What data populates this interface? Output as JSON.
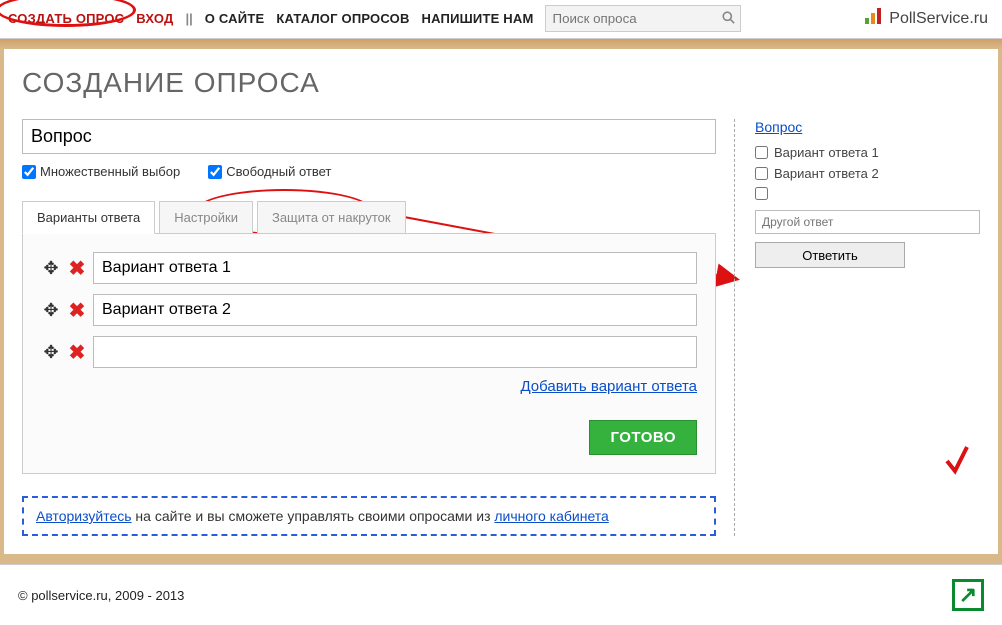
{
  "header": {
    "nav": {
      "create": "СОЗДАТЬ ОПРОС",
      "login": "ВХОД",
      "about": "О САЙТЕ",
      "catalog": "КАТАЛОГ ОПРОСОВ",
      "contact": "НАПИШИТЕ НАМ"
    },
    "search_placeholder": "Поиск опроса",
    "brand": "PollService.ru"
  },
  "page": {
    "title": "СОЗДАНИЕ ОПРОСА"
  },
  "editor": {
    "question_value": "Вопрос",
    "checks": {
      "multiple": "Множественный выбор",
      "free": "Свободный ответ"
    },
    "tabs": {
      "options": "Варианты ответа",
      "settings": "Настройки",
      "fraud": "Защита от накруток"
    },
    "options": [
      {
        "value": "Вариант ответа 1"
      },
      {
        "value": "Вариант ответа 2"
      },
      {
        "value": ""
      }
    ],
    "add_option": "Добавить вариант ответа",
    "done": "ГОТОВО",
    "auth_notice": {
      "login": "Авторизуйтесь",
      "mid": " на сайте и вы сможете управлять своими опросами из ",
      "cabinet": "личного кабинета"
    }
  },
  "preview": {
    "question": "Вопрос",
    "options": [
      "Вариант ответа 1",
      "Вариант ответа 2"
    ],
    "free_placeholder": "Другой ответ",
    "answer": "Ответить"
  },
  "footer": {
    "copyright": "© pollservice.ru, 2009 - 2013"
  }
}
